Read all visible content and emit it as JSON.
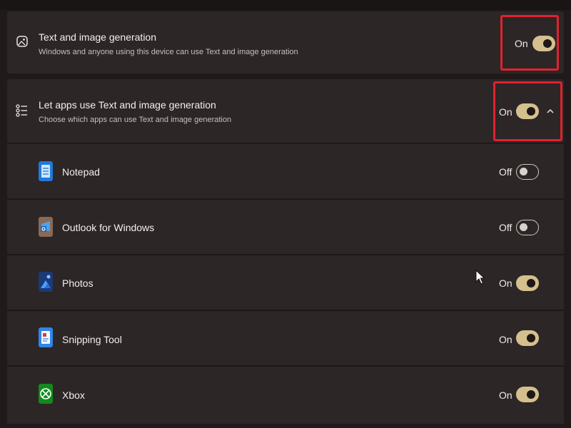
{
  "text_gen": {
    "title": "Text and image generation",
    "subtitle": "Windows and anyone using this device can use Text and image generation",
    "state": "On",
    "icon": "image-icon"
  },
  "apps_access": {
    "title": "Let apps use Text and image generation",
    "subtitle": "Choose which apps can use Text and image generation",
    "state": "On",
    "icon": "list-icon",
    "expand_icon": "chevron-up-icon"
  },
  "apps": [
    {
      "name": "Notepad",
      "state": "Off",
      "icon": "notepad-icon"
    },
    {
      "name": "Outlook for Windows",
      "state": "Off",
      "icon": "outlook-icon"
    },
    {
      "name": "Photos",
      "state": "On",
      "icon": "photos-icon"
    },
    {
      "name": "Snipping Tool",
      "state": "On",
      "icon": "snipping-tool-icon"
    },
    {
      "name": "Xbox",
      "state": "On",
      "icon": "xbox-icon"
    }
  ],
  "colors": {
    "toggle_on": "#d4c08e",
    "highlight": "#e0222d",
    "background": "#201a1a",
    "card": "#2d2626"
  }
}
